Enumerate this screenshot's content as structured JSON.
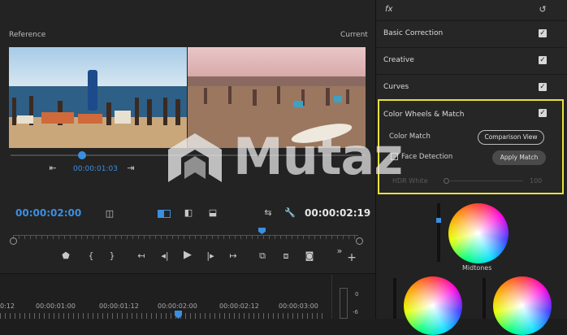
{
  "effects_header": {
    "fx_label": "fx"
  },
  "monitor": {
    "reference_label": "Reference",
    "current_label": "Current",
    "reference_timecode": "00:00:01:03",
    "playhead_timecode": "00:00:02:00",
    "duration_timecode": "00:00:02:19"
  },
  "timeline": {
    "ruler_labels": [
      "0:12",
      "00:00:01:00",
      "00:00:01:12",
      "00:00:02:00",
      "00:00:02:12",
      "00:00:03:00"
    ],
    "meter_labels": [
      "0",
      "-6"
    ]
  },
  "lumetri": {
    "sections": [
      {
        "label": "Basic Correction",
        "checked": true
      },
      {
        "label": "Creative",
        "checked": true
      },
      {
        "label": "Curves",
        "checked": true
      },
      {
        "label": "Color Wheels & Match",
        "checked": true
      }
    ],
    "color_match_label": "Color Match",
    "comparison_view_button": "Comparison View",
    "face_detection_label": "Face Detection",
    "apply_match_button": "Apply Match",
    "hdr_white_label": "HDR White",
    "hdr_white_value": "100",
    "midtones_label": "Midtones"
  },
  "watermark": {
    "text": "Mutaz"
  },
  "colors": {
    "accent_blue": "#3b8fe0",
    "highlight_yellow": "#e7e23a",
    "playhead_orange": "#ffb400"
  }
}
